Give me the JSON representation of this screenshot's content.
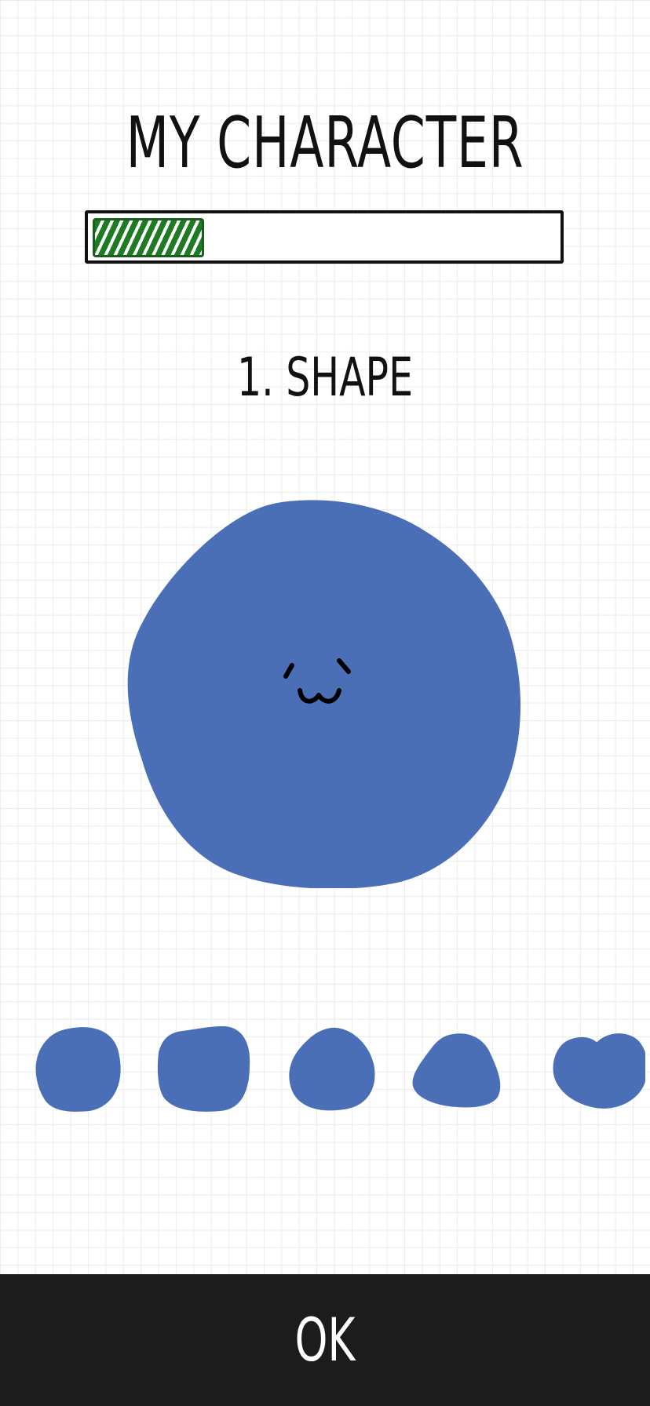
{
  "header": {
    "title": "MY CHARACTER"
  },
  "progress": {
    "fraction": 0.24,
    "color": "#1e7a23"
  },
  "step": {
    "label": "1. SHAPE"
  },
  "character": {
    "shape_color": "#4a6fb6",
    "face_icon": "cute-face-icon"
  },
  "shape_options": [
    {
      "name": "round-blob"
    },
    {
      "name": "rounded-square-blob"
    },
    {
      "name": "egg-blob"
    },
    {
      "name": "pear-blob"
    },
    {
      "name": "heart-blob"
    }
  ],
  "footer": {
    "ok_label": "OK"
  }
}
